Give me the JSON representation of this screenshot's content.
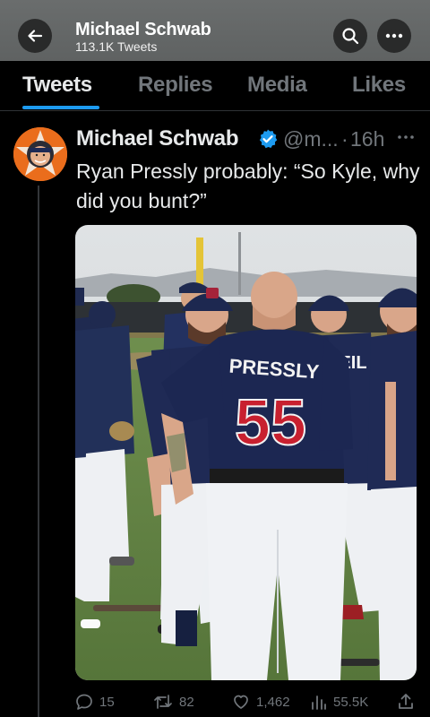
{
  "header": {
    "name": "Michael Schwab",
    "subtitle": "113.1K Tweets",
    "back_icon": "arrow-left-icon",
    "search_icon": "search-icon",
    "more_icon": "more-horizontal-icon"
  },
  "tabs": [
    {
      "label": "Tweets",
      "active": true
    },
    {
      "label": "Replies",
      "active": false
    },
    {
      "label": "Media",
      "active": false
    },
    {
      "label": "Likes",
      "active": false
    }
  ],
  "tweet": {
    "author": "Michael Schwab",
    "handle": "@m...",
    "dot": "·",
    "time": "16h",
    "text": "Ryan Pressly probably: “So Kyle, why did you bunt?”",
    "photo": {
      "jersey_name": "PRESSLY",
      "jersey_number": "55",
      "side_name": "NEIL"
    },
    "actions": {
      "replies": "15",
      "retweets": "82",
      "likes": "1,462",
      "views": "55.5K"
    }
  },
  "colors": {
    "accent": "#1d9bf0",
    "muted": "#71767b",
    "jersey": "#1c2752",
    "number_red": "#c8202f"
  }
}
